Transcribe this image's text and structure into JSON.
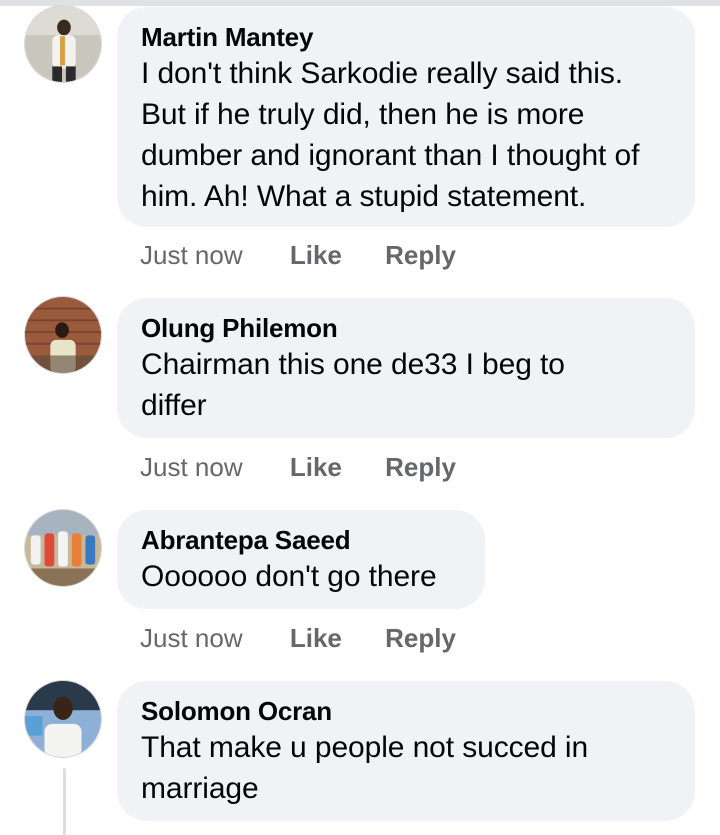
{
  "comments": [
    {
      "author": "Martin Mantey",
      "text": "I don't think Sarkodie really said this. But if he truly did, then he is more dumber and ignorant than I thought of him. Ah! What a stupid statement.",
      "time": "Just now",
      "like": "Like",
      "reply": "Reply"
    },
    {
      "author": "Olung Philemon",
      "text": "Chairman this one de33 I beg to differ",
      "time": "Just now",
      "like": "Like",
      "reply": "Reply"
    },
    {
      "author": "Abrantepa Saeed",
      "text": "Oooooo don't go there",
      "time": "Just now",
      "like": "Like",
      "reply": "Reply"
    },
    {
      "author": "Solomon Ocran",
      "text": "That make u people not succed in marriage"
    }
  ],
  "colors": {
    "bubble": "#f0f2f5",
    "text": "#050505",
    "meta": "#65676b"
  }
}
